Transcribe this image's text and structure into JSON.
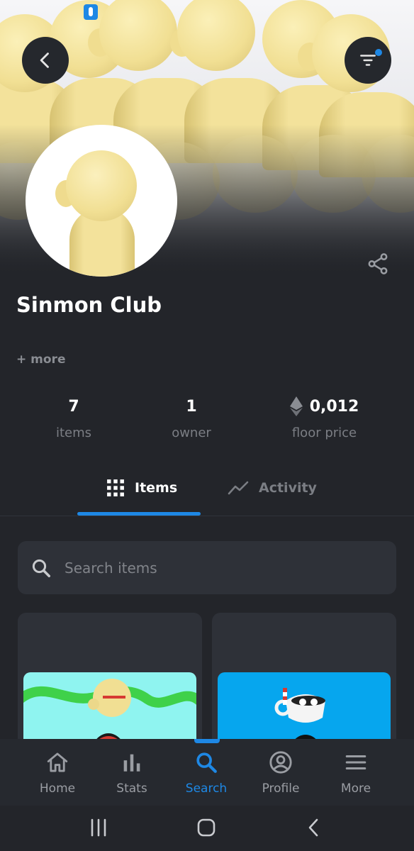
{
  "header": {
    "back_icon": "chevron-left-icon",
    "filter_icon": "filter-icon",
    "share_icon": "share-icon"
  },
  "collection": {
    "name": "Sinmon Club",
    "more_label": "+ more"
  },
  "stats": [
    {
      "value": "7",
      "label": "items"
    },
    {
      "value": "1",
      "label": "owner"
    },
    {
      "value": "0,012",
      "label": "floor price",
      "icon": "ethereum-icon"
    }
  ],
  "tabs": [
    {
      "label": "Items",
      "icon": "grid-icon",
      "active": true
    },
    {
      "label": "Activity",
      "icon": "activity-chart-icon",
      "active": false
    }
  ],
  "search": {
    "placeholder": "Search items",
    "value": ""
  },
  "bottom_nav": [
    {
      "label": "Home",
      "icon": "home-icon",
      "active": false
    },
    {
      "label": "Stats",
      "icon": "bar-chart-icon",
      "active": false
    },
    {
      "label": "Search",
      "icon": "search-icon",
      "active": true
    },
    {
      "label": "Profile",
      "icon": "profile-icon",
      "active": false
    },
    {
      "label": "More",
      "icon": "menu-icon",
      "active": false
    }
  ],
  "system_nav": [
    "recent-apps-icon",
    "home-button-icon",
    "back-icon"
  ],
  "colors": {
    "accent": "#1e88e5",
    "background": "#23252a",
    "surface": "#2e3138",
    "muted_text": "#7b7e84"
  }
}
